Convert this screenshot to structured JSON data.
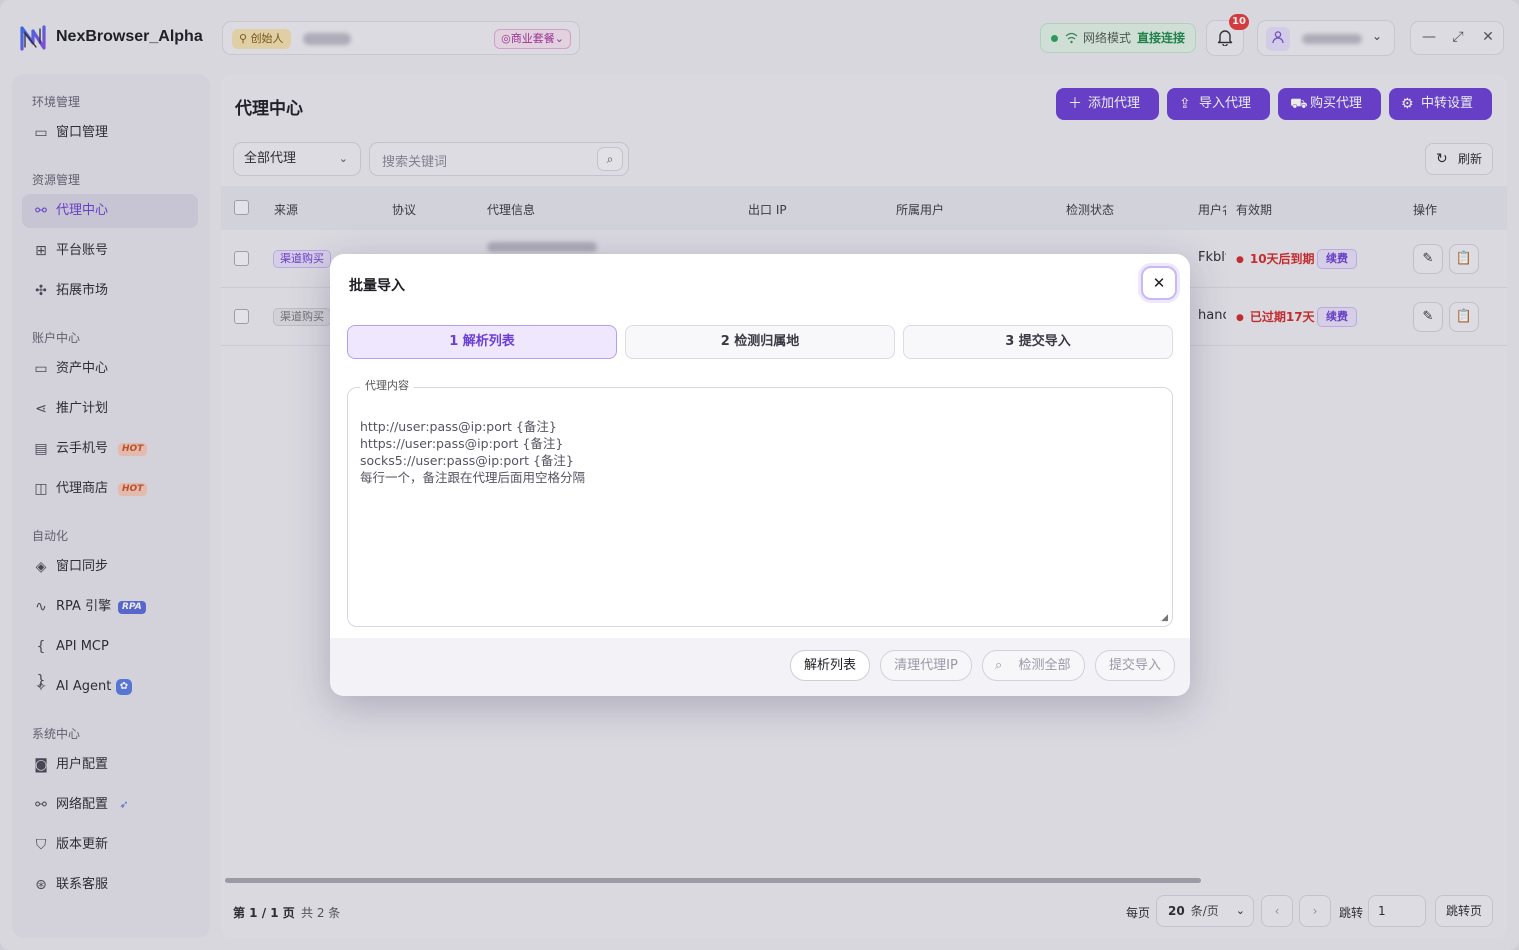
{
  "app": {
    "name": "NexBrowser_Alpha",
    "founder_badge": "创始人",
    "plan_badge": "商业套餐",
    "network_label": "网络模式",
    "network_value": "直接连接",
    "notification_count": "10"
  },
  "sidebar": {
    "sections": [
      {
        "title": "环境管理",
        "items": [
          {
            "label": "窗口管理",
            "icon": "window-icon"
          }
        ]
      },
      {
        "title": "资源管理",
        "items": [
          {
            "label": "代理中心",
            "icon": "network-icon",
            "active": true
          },
          {
            "label": "平台账号",
            "icon": "grid-icon"
          },
          {
            "label": "拓展市场",
            "icon": "puzzle-icon"
          }
        ]
      },
      {
        "title": "账户中心",
        "items": [
          {
            "label": "资产中心",
            "icon": "wallet-icon"
          },
          {
            "label": "推广计划",
            "icon": "share-icon"
          },
          {
            "label": "云手机号",
            "icon": "message-icon",
            "tag": "HOT"
          },
          {
            "label": "代理商店",
            "icon": "bag-icon",
            "tag": "HOT"
          }
        ]
      },
      {
        "title": "自动化",
        "items": [
          {
            "label": "窗口同步",
            "icon": "layers-icon"
          },
          {
            "label": "RPA 引擎",
            "icon": "pulse-icon",
            "tag": "RPA"
          },
          {
            "label": "API MCP",
            "icon": "braces-icon"
          },
          {
            "label": "AI Agent",
            "icon": "sparkle-icon"
          }
        ]
      },
      {
        "title": "系统中心",
        "items": [
          {
            "label": "用户配置",
            "icon": "user-config-icon"
          },
          {
            "label": "网络配置",
            "icon": "network-icon"
          },
          {
            "label": "版本更新",
            "icon": "shield-icon"
          },
          {
            "label": "联系客服",
            "icon": "support-icon"
          }
        ]
      }
    ]
  },
  "main": {
    "title": "代理中心",
    "toolbar": {
      "add": "添加代理",
      "import": "导入代理",
      "buy": "购买代理",
      "relay": "中转设置",
      "refresh": "刷新"
    },
    "filter": {
      "selected": "全部代理",
      "search_placeholder": "搜索关键词"
    },
    "table": {
      "headers": [
        "来源",
        "协议",
        "代理信息",
        "出口 IP",
        "所属用户",
        "检测状态",
        "用户名",
        "有效期",
        "操作"
      ],
      "rows": [
        {
          "source": "渠道购买",
          "username": "Fkblt",
          "validity": "10天后到期",
          "renew": "续费"
        },
        {
          "source": "渠道购买",
          "username": "hanc",
          "validity": "已过期17天",
          "renew": "续费"
        }
      ]
    },
    "pager": {
      "page_info": "第 1 / 1 页",
      "total": "共 2 条",
      "per_page_label": "每页",
      "per_page_value": "20",
      "per_page_unit": "条/页",
      "jump_label": "跳转",
      "jump_value": "1",
      "jump_button": "跳转页"
    }
  },
  "modal": {
    "title": "批量导入",
    "steps": [
      "1 解析列表",
      "2 检测归属地",
      "3 提交导入"
    ],
    "field_legend": "代理内容",
    "placeholder_lines": [
      "http://user:pass@ip:port {备注}",
      "https://user:pass@ip:port {备注}",
      "socks5://user:pass@ip:port {备注}",
      "每行一个，备注跟在代理后面用空格分隔"
    ],
    "footer": {
      "parse": "解析列表",
      "clear": "清理代理IP",
      "check_all": "检测全部",
      "submit": "提交导入"
    }
  },
  "colors": {
    "accent": "#6b3fd3",
    "danger": "#d12a2a",
    "success": "#27a35a"
  }
}
